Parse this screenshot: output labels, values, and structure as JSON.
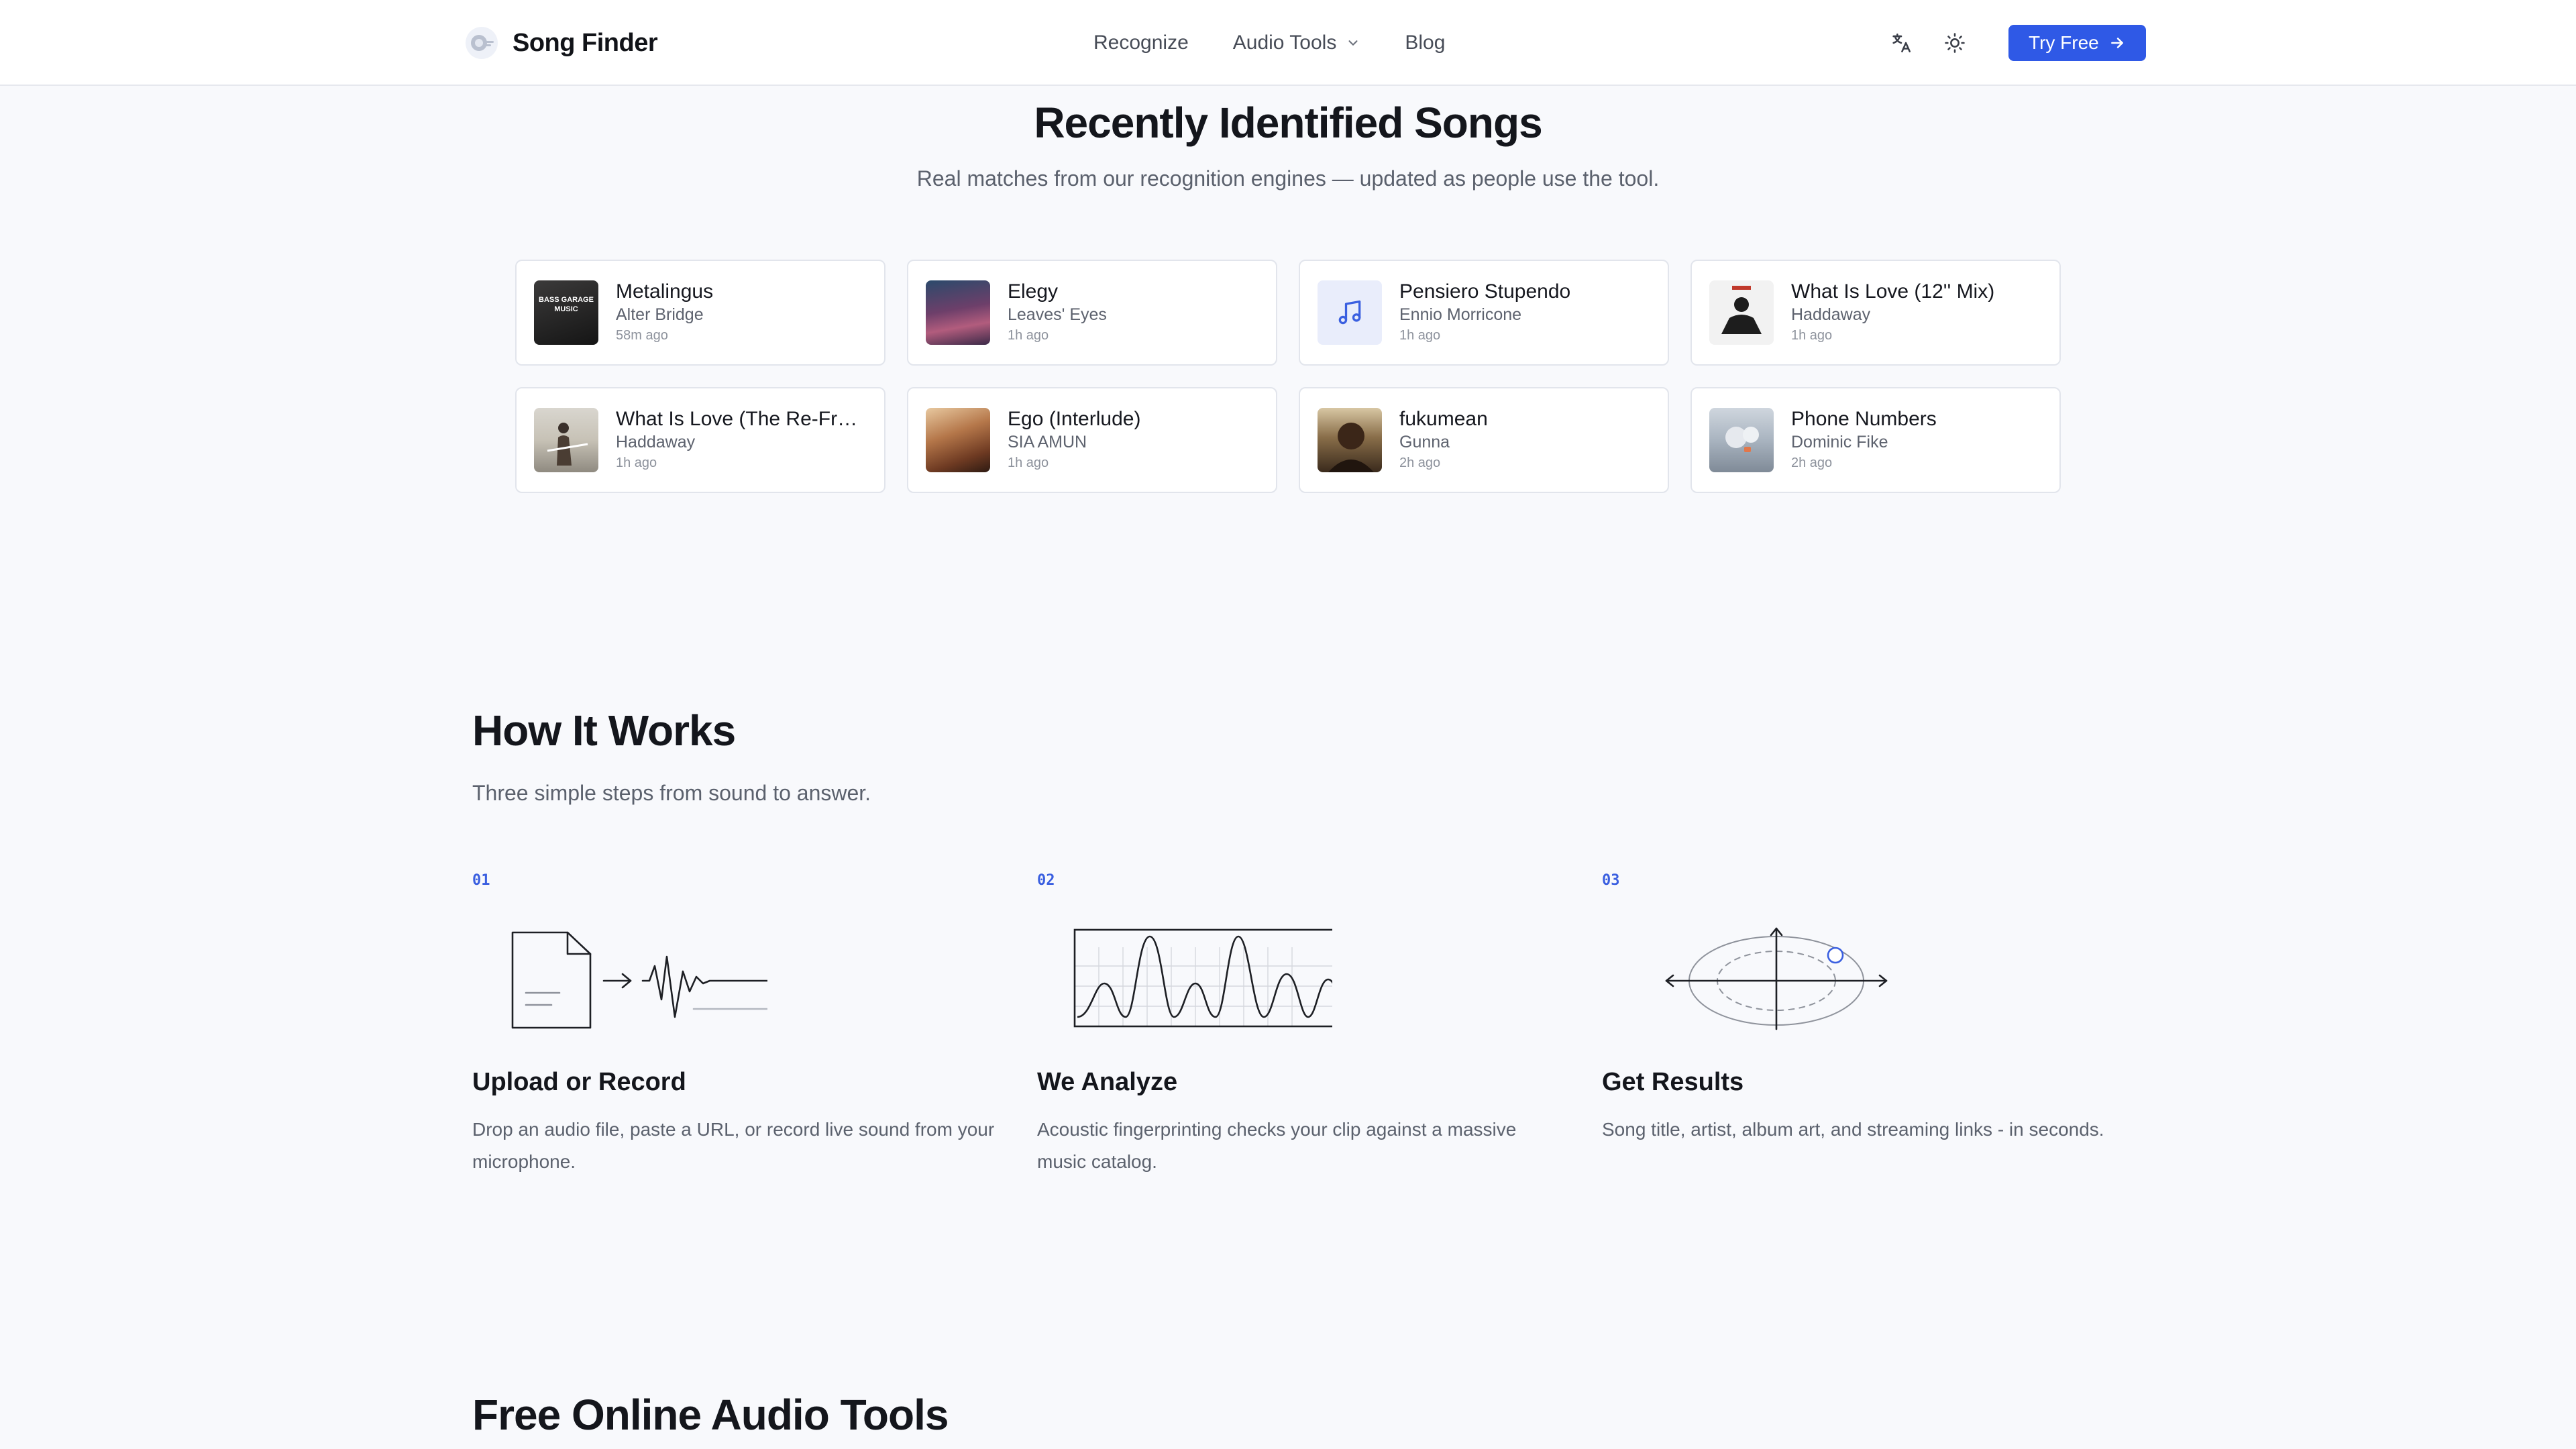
{
  "header": {
    "brand": "Song Finder",
    "nav": {
      "recognize": "Recognize",
      "audio_tools": "Audio Tools",
      "blog": "Blog"
    },
    "cta": "Try Free",
    "accent_color": "#2f59e6"
  },
  "recent": {
    "title": "Recently Identified Songs",
    "subtitle": "Real matches from our recognition engines — updated as people use the tool.",
    "songs": [
      {
        "title": "Metalingus",
        "artist": "Alter Bridge",
        "time": "58m ago",
        "art_text": "BASS GARAGE MUSIC"
      },
      {
        "title": "Elegy",
        "artist": "Leaves' Eyes",
        "time": "1h ago"
      },
      {
        "title": "Pensiero Stupendo",
        "artist": "Ennio Morricone",
        "time": "1h ago",
        "art_icon": "music-note-icon"
      },
      {
        "title": "What Is Love (12'' Mix)",
        "artist": "Haddaway",
        "time": "1h ago"
      },
      {
        "title": "What Is Love (The Re-Fresh Mixes)",
        "artist": "Haddaway",
        "time": "1h ago"
      },
      {
        "title": "Ego (Interlude)",
        "artist": "SIA AMUN",
        "time": "1h ago"
      },
      {
        "title": "fukumean",
        "artist": "Gunna",
        "time": "2h ago"
      },
      {
        "title": "Phone Numbers",
        "artist": "Dominic Fike",
        "time": "2h ago"
      }
    ]
  },
  "how": {
    "title": "How It Works",
    "subtitle": "Three simple steps from sound to answer.",
    "steps": [
      {
        "num": "01",
        "title": "Upload or Record",
        "desc": "Drop an audio file, paste a URL, or record live sound from your microphone.",
        "icon": "file-to-waveform-icon"
      },
      {
        "num": "02",
        "title": "We Analyze",
        "desc": "Acoustic fingerprinting checks your clip against a massive music catalog.",
        "icon": "spectrogram-icon"
      },
      {
        "num": "03",
        "title": "Get Results",
        "desc": "Song title, artist, album art, and streaming links - in seconds.",
        "icon": "match-target-icon"
      }
    ]
  },
  "tools": {
    "title": "Free Online Audio Tools"
  }
}
